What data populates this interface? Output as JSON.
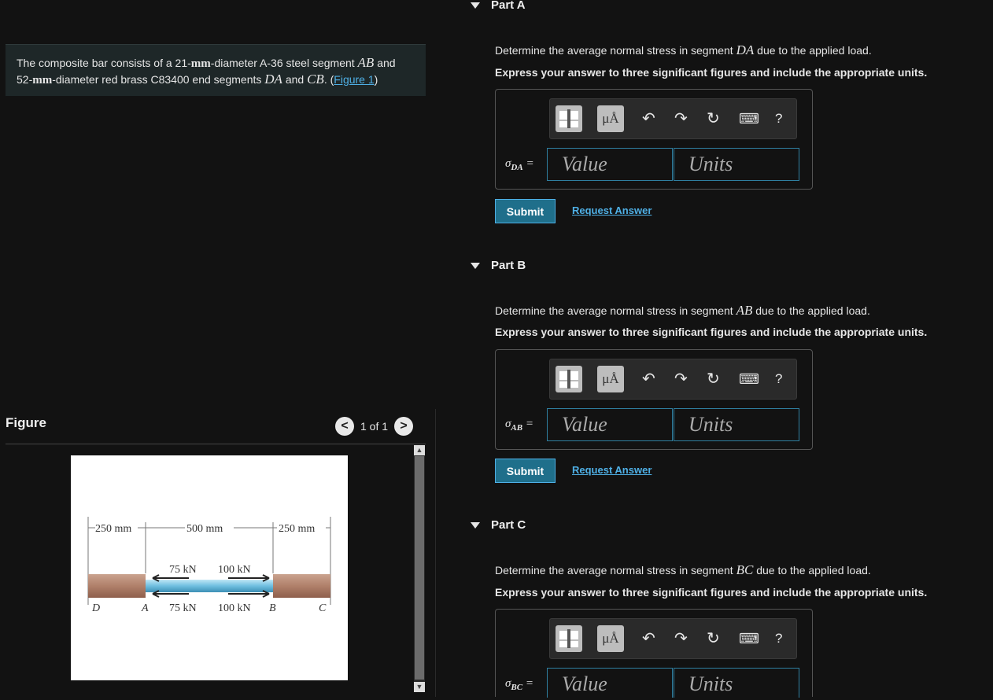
{
  "problem": {
    "t1": "The composite bar consists of a 21-",
    "u1": "mm",
    "t2": "-diameter A-36 steel segment ",
    "v1": "AB",
    "t3": " and",
    "t4": "52-",
    "u2": "mm",
    "t5": "-diameter red brass C83400 end segments ",
    "v2": "DA",
    "t6": " and ",
    "v3": "CB",
    "t7": ". (",
    "link": "Figure 1",
    "t8": ")"
  },
  "figure": {
    "title": "Figure",
    "pager_prev": "<",
    "pager_text": "1 of 1",
    "pager_next": ">",
    "dim_left": "250 mm",
    "dim_mid": "500 mm",
    "dim_right": "250 mm",
    "force_a_top": "75 kN",
    "force_b_top": "100 kN",
    "force_a_bottom": "75 kN",
    "force_b_bottom": "100 kN",
    "pt_d": "D",
    "pt_a": "A",
    "pt_b": "B",
    "pt_c": "C"
  },
  "toolbar": {
    "units_btn": "μÅ",
    "undo": "↶",
    "redo": "↷",
    "reset": "↻",
    "keyboard": "⌨",
    "help": "?"
  },
  "parts": [
    {
      "label": "Part A",
      "question_pre": "Determine the average normal stress in segment ",
      "segment": "DA",
      "question_post": " due to the applied load.",
      "instruction": "Express your answer to three significant figures and include the appropriate units.",
      "symbol": "σ",
      "sub": "DA",
      "eq": " =",
      "value_placeholder": "Value",
      "units_placeholder": "Units",
      "submit": "Submit",
      "request": "Request Answer"
    },
    {
      "label": "Part B",
      "question_pre": "Determine the average normal stress in segment ",
      "segment": "AB",
      "question_post": " due to the applied load.",
      "instruction": "Express your answer to three significant figures and include the appropriate units.",
      "symbol": "σ",
      "sub": "AB",
      "eq": " =",
      "value_placeholder": "Value",
      "units_placeholder": "Units",
      "submit": "Submit",
      "request": "Request Answer"
    },
    {
      "label": "Part C",
      "question_pre": "Determine the average normal stress in segment ",
      "segment": "BC",
      "question_post": " due to the applied load.",
      "instruction": "Express your answer to three significant figures and include the appropriate units.",
      "symbol": "σ",
      "sub": "BC",
      "eq": " =",
      "value_placeholder": "Value",
      "units_placeholder": "Units"
    }
  ]
}
